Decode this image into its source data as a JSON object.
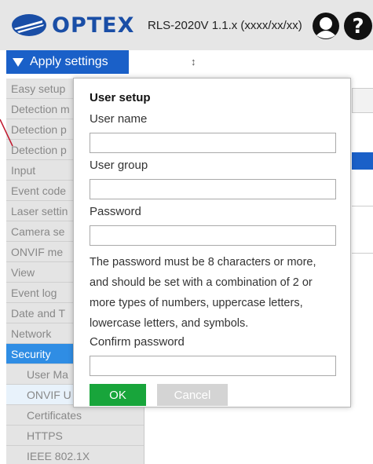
{
  "header": {
    "logo_text": "OPTEX",
    "version": "RLS-2020V 1.1.x (xxxx/xx/xx)"
  },
  "toolbar": {
    "apply_label": "Apply settings",
    "resize_glyph": "↕"
  },
  "sidebar": {
    "items": [
      {
        "label": "Easy setup"
      },
      {
        "label": "Detection m"
      },
      {
        "label": "Detection p"
      },
      {
        "label": "Detection p"
      },
      {
        "label": "Input"
      },
      {
        "label": "Event code"
      },
      {
        "label": "Laser settin"
      },
      {
        "label": "Camera se"
      },
      {
        "label": "ONVIF me"
      },
      {
        "label": "View"
      },
      {
        "label": "Event log"
      },
      {
        "label": "Date and T"
      },
      {
        "label": "Network"
      },
      {
        "label": "Security"
      },
      {
        "label": "User Ma"
      },
      {
        "label": "ONVIF U"
      },
      {
        "label": "Certificates"
      },
      {
        "label": "HTTPS"
      },
      {
        "label": "IEEE 802.1X"
      }
    ]
  },
  "dialog": {
    "title": "User setup",
    "user_name_label": "User name",
    "user_name_value": "",
    "user_group_label": "User group",
    "user_group_value": "",
    "password_label": "Password",
    "password_value": "",
    "note_lines": [
      "The password must be 8 characters or more,",
      "and should be set with a combination of 2 or",
      "more types of numbers, uppercase letters,",
      "lowercase letters, and symbols."
    ],
    "confirm_label": "Confirm password",
    "confirm_value": "",
    "ok_label": "OK",
    "cancel_label": "Cancel"
  },
  "colors": {
    "brand_blue": "#1a60c8",
    "active_blue": "#2f8de4",
    "ok_green": "#18a53b",
    "pointer_red": "#c0182e"
  },
  "icons": {
    "logo": "optex-logo-icon",
    "user": "user-icon",
    "help": "help-icon"
  }
}
